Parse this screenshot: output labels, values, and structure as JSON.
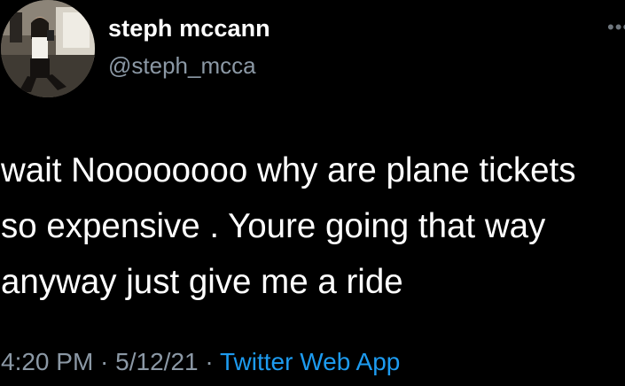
{
  "author": {
    "display_name": "steph mccann",
    "handle": "@steph_mcca"
  },
  "more_icon": "more-dots-icon",
  "tweet_lines": [
    "wait Noooooooo why are plane tickets",
    "so expensive . Youre going that way",
    "anyway just give me a ride"
  ],
  "meta": {
    "time": "4:20 PM",
    "separator": " · ",
    "date": "5/12/21",
    "source": "Twitter Web App"
  },
  "colors": {
    "background": "#000000",
    "text": "#ffffff",
    "secondary": "#8b98a5",
    "link": "#1d9bf0"
  }
}
